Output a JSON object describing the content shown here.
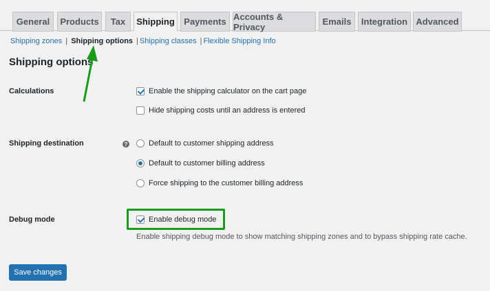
{
  "tabs": [
    {
      "label": "General"
    },
    {
      "label": "Products"
    },
    {
      "label": "Tax"
    },
    {
      "label": "Shipping",
      "active": true
    },
    {
      "label": "Payments"
    },
    {
      "label": "Accounts & Privacy"
    },
    {
      "label": "Emails"
    },
    {
      "label": "Integration"
    },
    {
      "label": "Advanced"
    }
  ],
  "subnav": {
    "shipping_zones": "Shipping zones",
    "shipping_options": "Shipping options",
    "shipping_classes": "Shipping classes",
    "flexible_shipping_info": "Flexible Shipping Info",
    "separator": "|"
  },
  "section_title": "Shipping options",
  "calculations": {
    "label": "Calculations",
    "enable_calculator": {
      "label": "Enable the shipping calculator on the cart page",
      "checked": true
    },
    "hide_costs": {
      "label": "Hide shipping costs until an address is entered",
      "checked": false
    }
  },
  "destination": {
    "label": "Shipping destination",
    "help_icon": "?",
    "options": [
      {
        "label": "Default to customer shipping address",
        "checked": false
      },
      {
        "label": "Default to customer billing address",
        "checked": true
      },
      {
        "label": "Force shipping to the customer billing address",
        "checked": false
      }
    ]
  },
  "debug": {
    "label": "Debug mode",
    "enable": {
      "label": "Enable debug mode",
      "checked": true
    },
    "description": "Enable shipping debug mode to show matching shipping zones and to bypass shipping rate cache."
  },
  "save_button": "Save changes",
  "colors": {
    "accent": "#2271b1",
    "annotation_green": "#1a9a1a"
  }
}
